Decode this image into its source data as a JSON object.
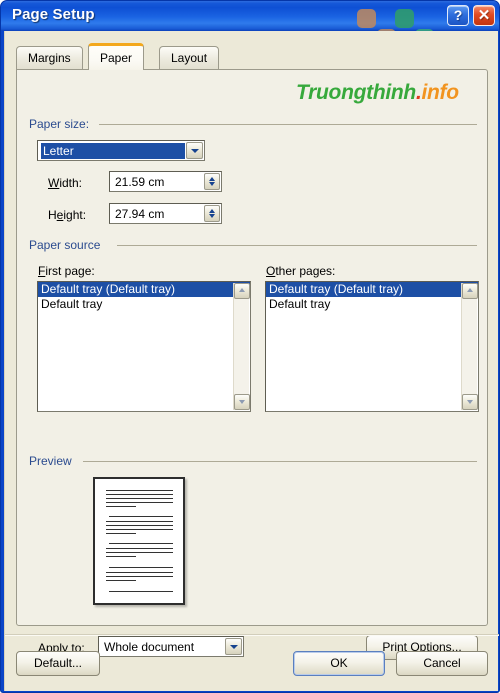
{
  "window": {
    "title": "Page Setup",
    "help_button": "?",
    "close_button": "✕"
  },
  "watermark": {
    "text_green": "Truongthinh",
    "text_dot": ".",
    "text_orange": "info",
    "color_green": "#37a93c",
    "color_orange": "#f2941f",
    "color_red": "#e03a20"
  },
  "tabs": [
    {
      "label": "Margins",
      "active": false
    },
    {
      "label": "Paper",
      "active": true
    },
    {
      "label": "Layout",
      "active": false
    }
  ],
  "paper_size": {
    "group_label": "Paper size:",
    "size_value": "Letter",
    "width_label": "Width:",
    "width_value": "21.59 cm",
    "height_label": "Height:",
    "height_value": "27.94 cm"
  },
  "paper_source": {
    "group_label": "Paper source",
    "first_page_label": "First page:",
    "other_pages_label": "Other pages:",
    "first_page_items": [
      {
        "label": "Default tray (Default tray)",
        "selected": true
      },
      {
        "label": "Default tray",
        "selected": false
      }
    ],
    "other_pages_items": [
      {
        "label": "Default tray (Default tray)",
        "selected": true
      },
      {
        "label": "Default tray",
        "selected": false
      }
    ]
  },
  "preview": {
    "group_label": "Preview"
  },
  "apply": {
    "label": "Apply to:",
    "value": "Whole document"
  },
  "buttons": {
    "print_options": "Print Options...",
    "default": "Default...",
    "ok": "OK",
    "cancel": "Cancel"
  },
  "chart_data": null
}
